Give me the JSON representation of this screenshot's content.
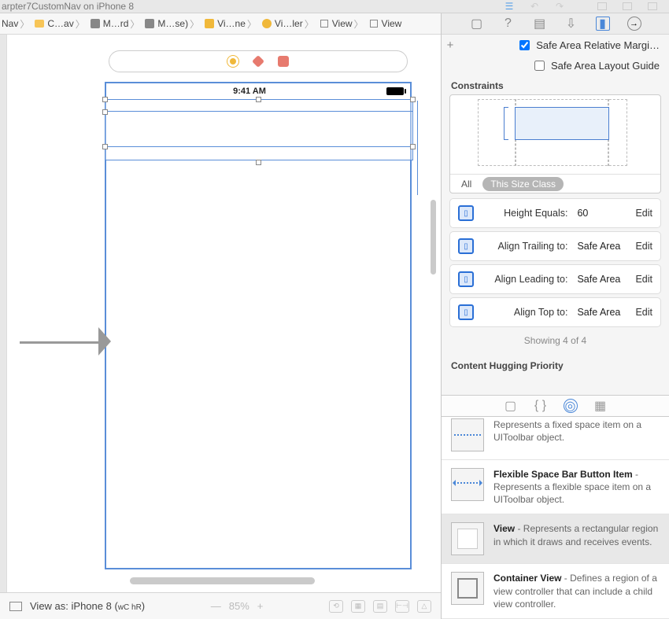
{
  "title": "arpter7CustomNav on iPhone 8",
  "crumbs": [
    "Nav",
    "C…av",
    "M…rd",
    "M…se)",
    "Vi…ne",
    "Vi…ler",
    "View",
    "View"
  ],
  "status_time": "9:41 AM",
  "safe_margin": "Safe Area Relative Margi…",
  "safe_guide": "Safe Area Layout Guide",
  "constraints_label": "Constraints",
  "filter_all": "All",
  "filter_this": "This Size Class",
  "constraints": [
    {
      "label": "Height Equals:",
      "value": "60",
      "edit": "Edit"
    },
    {
      "label": "Align Trailing to:",
      "value": "Safe Area",
      "edit": "Edit"
    },
    {
      "label": "Align Leading to:",
      "value": "Safe Area",
      "edit": "Edit"
    },
    {
      "label": "Align Top to:",
      "value": "Safe Area",
      "edit": "Edit"
    }
  ],
  "showing": "Showing 4 of 4",
  "hugging": "Content Hugging Priority",
  "lib": {
    "fixed_space": "Represents a fixed space item on a UIToolbar object.",
    "flex_title": "Flexible Space Bar Button Item",
    "flex_desc": " - Represents a flexible space item on a UIToolbar object.",
    "view_title": "View",
    "view_desc": " - Represents a rectangular region in which it draws and receives events.",
    "cont_title": "Container View",
    "cont_desc": " - Defines a region of a view controller that can include a child view controller."
  },
  "viewas_label": "View as: iPhone 8 (",
  "viewas_wc": "wC",
  "viewas_hr": " hR",
  "viewas_close": ")",
  "zoom": "85%"
}
